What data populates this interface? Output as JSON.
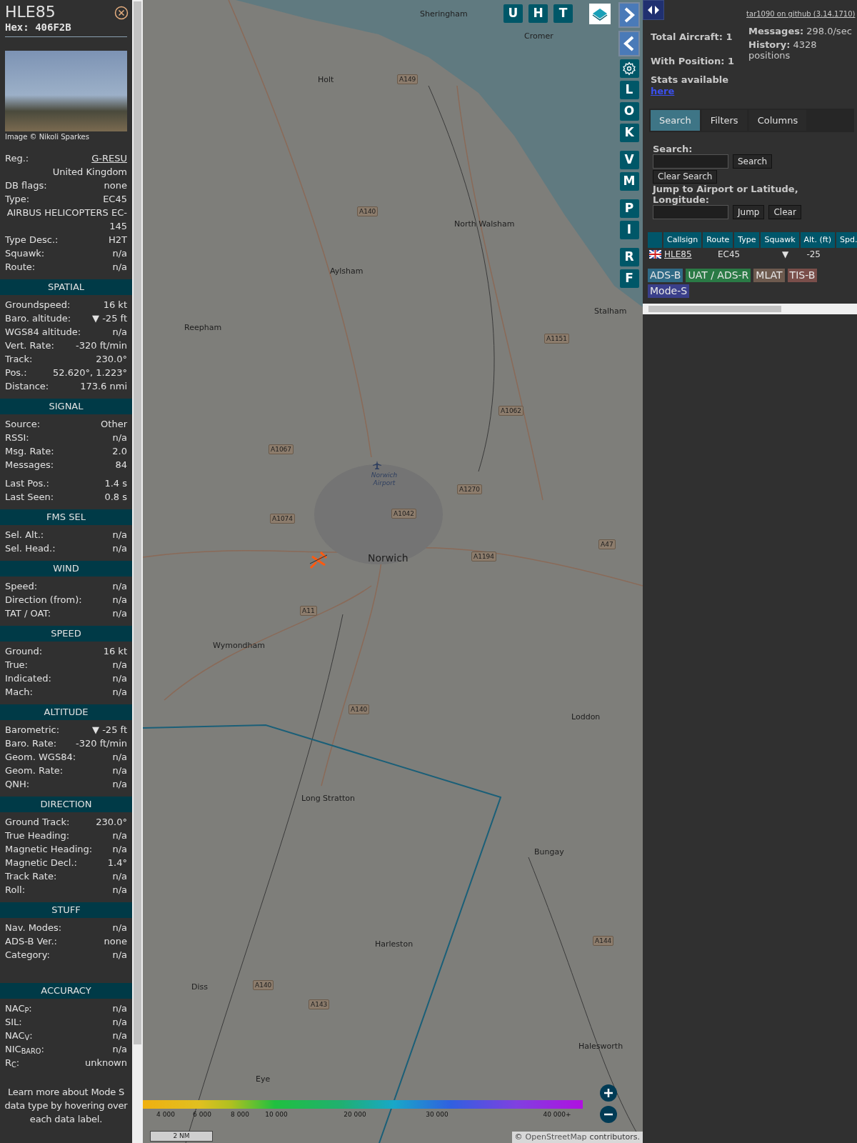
{
  "aircraft": {
    "callsign": "HLE85",
    "hex": "Hex: 406F2B",
    "photo_credit": "Image © Nikoli Sparkes"
  },
  "info_rows": [
    {
      "kind": "link",
      "label": "Reg.:",
      "value": "G-RESU"
    },
    {
      "kind": "value",
      "value": "United Kingdom"
    },
    {
      "kind": "pair",
      "label": "DB flags:",
      "value": "none"
    },
    {
      "kind": "pair",
      "label": "Type:",
      "value": "EC45"
    },
    {
      "kind": "value",
      "value": "AIRBUS HELICOPTERS EC-145"
    },
    {
      "kind": "pair",
      "label": "Type Desc.:",
      "value": "H2T"
    },
    {
      "kind": "pair",
      "label": "Squawk:",
      "value": "n/a"
    },
    {
      "kind": "pair",
      "label": "Route:",
      "value": "n/a"
    }
  ],
  "sections": [
    {
      "title": "SPATIAL",
      "rows": [
        {
          "label": "Groundspeed:",
          "value": "16 kt"
        },
        {
          "label": "Baro. altitude:",
          "value": "▼ -25 ft"
        },
        {
          "label": "WGS84 altitude:",
          "value": "n/a"
        },
        {
          "label": "Vert. Rate:",
          "value": "-320 ft/min"
        },
        {
          "label": "Track:",
          "value": "230.0°"
        },
        {
          "label": "Pos.:",
          "value": "52.620°, 1.223°"
        },
        {
          "label": "Distance:",
          "value": "173.6 nmi"
        }
      ]
    },
    {
      "title": "SIGNAL",
      "rows": [
        {
          "label": "Source:",
          "value": "Other"
        },
        {
          "label": "RSSI:",
          "value": "n/a"
        },
        {
          "label": "Msg. Rate:",
          "value": "2.0"
        },
        {
          "label": "Messages:",
          "value": "84"
        },
        {
          "label": "Last Pos.:",
          "value": "1.4 s"
        },
        {
          "label": "Last Seen:",
          "value": "0.8 s"
        }
      ]
    },
    {
      "title": "FMS SEL",
      "rows": [
        {
          "label": "Sel. Alt.:",
          "value": "n/a"
        },
        {
          "label": "Sel. Head.:",
          "value": "n/a"
        }
      ]
    },
    {
      "title": "WIND",
      "rows": [
        {
          "label": "Speed:",
          "value": "n/a"
        },
        {
          "label": "Direction (from):",
          "value": "n/a"
        },
        {
          "label": "TAT / OAT:",
          "value": "n/a"
        }
      ]
    },
    {
      "title": "SPEED",
      "rows": [
        {
          "label": "Ground:",
          "value": "16 kt"
        },
        {
          "label": "True:",
          "value": "n/a"
        },
        {
          "label": "Indicated:",
          "value": "n/a"
        },
        {
          "label": "Mach:",
          "value": "n/a"
        }
      ]
    },
    {
      "title": "ALTITUDE",
      "rows": [
        {
          "label": "Barometric:",
          "value": "▼ -25 ft"
        },
        {
          "label": "Baro. Rate:",
          "value": "-320 ft/min"
        },
        {
          "label": "Geom. WGS84:",
          "value": "n/a"
        },
        {
          "label": "Geom. Rate:",
          "value": "n/a"
        },
        {
          "label": "QNH:",
          "value": "n/a"
        }
      ]
    },
    {
      "title": "DIRECTION",
      "rows": [
        {
          "label": "Ground Track:",
          "value": "230.0°"
        },
        {
          "label": "True Heading:",
          "value": "n/a"
        },
        {
          "label": "Magnetic Heading:",
          "value": "n/a"
        },
        {
          "label": "Magnetic Decl.:",
          "value": "1.4°"
        },
        {
          "label": "Track Rate:",
          "value": "n/a"
        },
        {
          "label": "Roll:",
          "value": "n/a"
        }
      ]
    },
    {
      "title": "STUFF",
      "rows": [
        {
          "label": "Nav. Modes:",
          "value": "n/a"
        },
        {
          "label": "ADS-B Ver.:",
          "value": "none"
        },
        {
          "label": "Category:",
          "value": "n/a"
        }
      ]
    },
    {
      "title": "ACCURACY",
      "rows": [
        {
          "label": "NAC$_{P}$:",
          "value": "n/a"
        },
        {
          "label": "SIL:",
          "value": "n/a"
        },
        {
          "label": "NAC$_{V}$:",
          "value": "n/a"
        },
        {
          "label": "NIC$_{BARO}$:",
          "value": "n/a"
        },
        {
          "label": "R$_{C}$:",
          "value": "unknown"
        }
      ]
    }
  ],
  "footer_note": "Learn more about Mode S data type by hovering over each data label.",
  "map": {
    "top_buttons": [
      "U",
      "H",
      "T"
    ],
    "side_buttons": [
      "L",
      "O",
      "K",
      "V",
      "M",
      "P",
      "I",
      "R",
      "F"
    ],
    "towns": [
      "Sheringham",
      "Cromer",
      "Holt",
      "North Walsham",
      "Aylsham",
      "Reepham",
      "Stalham",
      "Norwich",
      "Wymondham",
      "Loddon",
      "Long Stratton",
      "Bungay",
      "Harleston",
      "Diss",
      "Halesworth",
      "Eye"
    ],
    "airport": "Norwich Airport",
    "roads": [
      "A149",
      "A140",
      "A1151",
      "A1062",
      "A1067",
      "A1270",
      "A1042",
      "A1074",
      "A47",
      "A1194",
      "A11",
      "A140",
      "A144",
      "A140",
      "A143"
    ],
    "legend_ticks": [
      "4 000",
      "6 000",
      "8 000",
      "10 000",
      "20 000",
      "30 000",
      "40 000+"
    ],
    "scale": "2 NM",
    "attribution": {
      "prefix": "©",
      "link": "OpenStreetMap",
      "suffix": "contributors."
    }
  },
  "panel": {
    "github_link": "tar1090 on github (3.14.1710)",
    "stats_left": [
      "Total Aircraft: 1",
      "With Position: 1"
    ],
    "stats_right": [
      "**Messages:** 298.0/sec",
      "**History:** 4328 positions"
    ],
    "stats_link_label": "Stats available",
    "stats_link": "here",
    "tabs": [
      {
        "label": "Search",
        "selected": true
      },
      {
        "label": "Filters",
        "selected": false
      },
      {
        "label": "Columns",
        "selected": false
      }
    ],
    "search_label": "Search:",
    "search_button": "Search",
    "clear_search_button": "Clear Search",
    "jump_label": "Jump to Airport or Latitude, Longitude:",
    "jump_button": "Jump",
    "clear_button": "Clear",
    "table": {
      "columns": [
        "Callsign",
        "Route",
        "Type",
        "Squawk",
        "Alt. (ft)",
        "Spd."
      ],
      "rows": [
        {
          "callsign": "HLE85",
          "type": "EC45",
          "alt_trend": "▼",
          "altitude": "-25"
        }
      ]
    },
    "sources": [
      {
        "label": "ADS-B",
        "color": "#2f6a86"
      },
      {
        "label": "UAT / ADS-R",
        "color": "#2a7a45"
      },
      {
        "label": "MLAT",
        "color": "#6d5a4e"
      },
      {
        "label": "TIS-B",
        "color": "#7a4e4a"
      },
      {
        "label": "Mode-S",
        "color": "#3a3f8a"
      }
    ]
  }
}
